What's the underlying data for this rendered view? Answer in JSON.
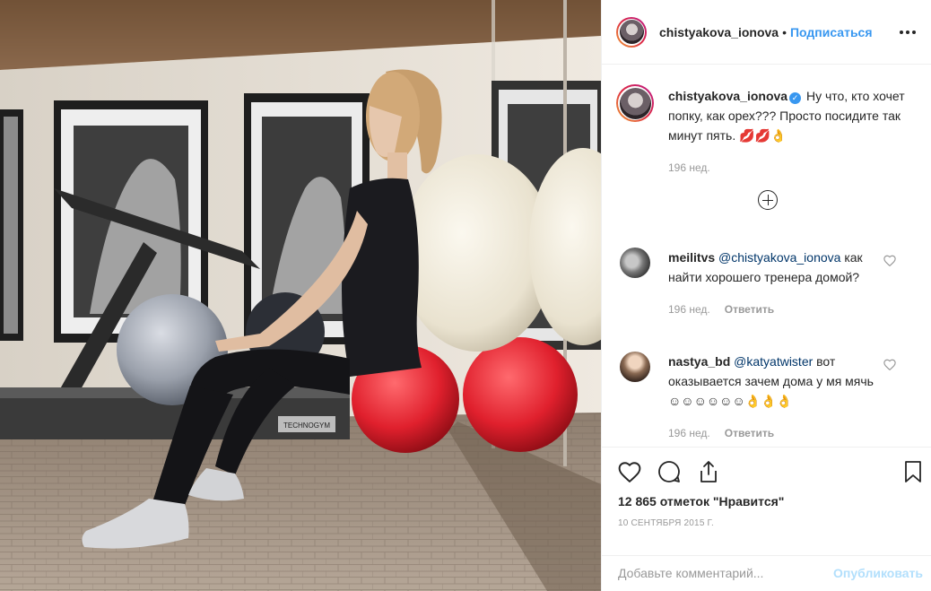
{
  "post": {
    "username": "chistyakova_ionova",
    "separator": "•",
    "follow_label": "Подписаться",
    "more_label": "•••"
  },
  "caption": {
    "username": "chistyakova_ionova",
    "text": "Ну что, кто хочет попку, как орех??? Просто посидите так минут пять. 💋💋👌",
    "time": "196 нед."
  },
  "comments": [
    {
      "username": "meilitvs",
      "mention": "@chistyakova_ionova",
      "text": "как найти хорошего тренера домой?",
      "time": "196 нед.",
      "reply": "Ответить"
    },
    {
      "username": "nastya_bd",
      "mention": "@katyatwister",
      "text": "вот оказывается зачем дома у мя мячь☺☺☺☺☺☺👌👌👌",
      "time": "196 нед.",
      "reply": "Ответить"
    }
  ],
  "stats": {
    "likes": "12 865 отметок \"Нравится\"",
    "date": "10 СЕНТЯБРЯ 2015 Г."
  },
  "add_comment": {
    "placeholder": "Добавьте комментарий...",
    "publish": "Опубликовать"
  },
  "photo": {
    "equipment_brand": "TECHNOGYM"
  },
  "colors": {
    "accent": "#3897f0",
    "muted": "#999999",
    "publish_disabled": "#b2dffc"
  }
}
